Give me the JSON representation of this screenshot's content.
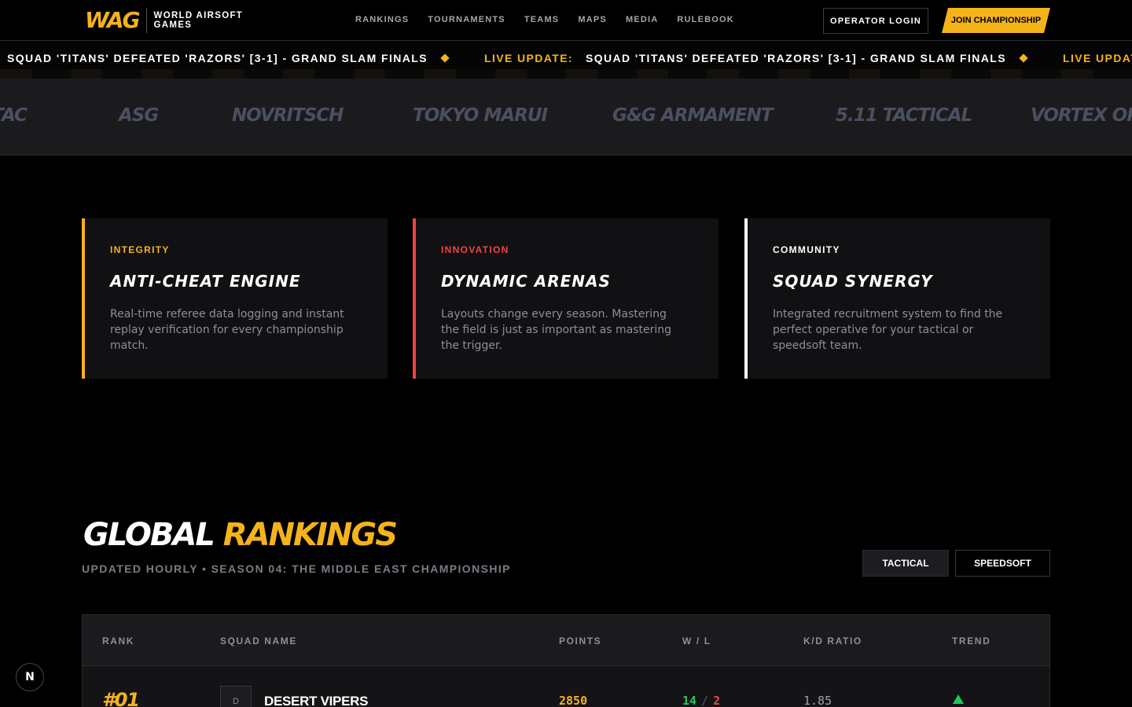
{
  "nav": {
    "logo_mark": "WAG",
    "logo_line1": "WORLD AIRSOFT",
    "logo_line2": "GAMES",
    "links": [
      "RANKINGS",
      "TOURNAMENTS",
      "TEAMS",
      "MAPS",
      "MEDIA",
      "RULEBOOK"
    ],
    "login_label": "OPERATOR LOGIN",
    "join_label": "JOIN CHAMPIONSHIP"
  },
  "ticker": {
    "headline": "SQUAD 'TITANS' DEFEATED 'RAZORS' [3-1] - GRAND SLAM FINALS",
    "live_label": "LIVE UPDATE:"
  },
  "sponsors": [
    "KRYTAC",
    "ASG",
    "NOVRITSCH",
    "TOKYO MARUI",
    "G&G ARMAMENT",
    "5.11 TACTICAL",
    "VORTEX OPTICS"
  ],
  "features": [
    {
      "eyebrow": "INTEGRITY",
      "title": "ANTI-CHEAT ENGINE",
      "text": "Real-time referee data logging and instant replay verification for every championship match.",
      "accent": "#f5b31a"
    },
    {
      "eyebrow": "INNOVATION",
      "title": "DYNAMIC ARENAS",
      "text": "Layouts change every season. Mastering the field is just as important as mastering the trigger.",
      "accent": "#ef4444"
    },
    {
      "eyebrow": "COMMUNITY",
      "title": "SQUAD SYNERGY",
      "text": "Integrated recruitment system to find the perfect operative for your tactical or speedsoft team.",
      "accent": "#ffffff"
    }
  ],
  "rankings": {
    "title_main": "GLOBAL",
    "title_accent": "RANKINGS",
    "subtitle": "UPDATED HOURLY • SEASON 04: THE MIDDLE EAST CHAMPIONSHIP",
    "tabs": [
      "TACTICAL",
      "SPEEDSOFT"
    ],
    "columns": [
      "RANK",
      "SQUAD NAME",
      "POINTS",
      "W / L",
      "K/D RATIO",
      "TREND"
    ],
    "rows": [
      {
        "rank": "#01",
        "avatar": "D",
        "name": "DESERT VIPERS",
        "points": "2850",
        "wins": "14",
        "wl_sep": "/",
        "losses": "2",
        "kd": "1.85",
        "trend": "up",
        "trend_icon": "triangle-up-icon"
      }
    ]
  },
  "fab": {
    "label": "N"
  },
  "colors": {
    "accent": "#f5b31a",
    "danger": "#ef4444",
    "success": "#22c55e",
    "background": "#000000"
  }
}
